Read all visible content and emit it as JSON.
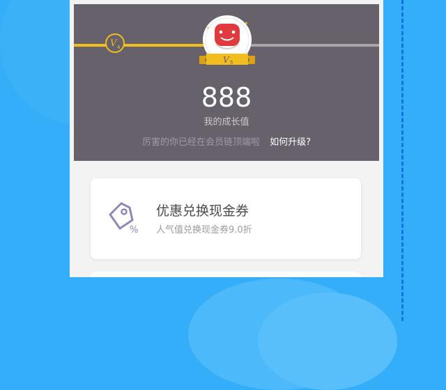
{
  "colors": {
    "background": "#34aef8",
    "banner": "#67616b",
    "progress_done": "#f2bd1f",
    "progress_todo": "#a7a5a6",
    "badge_red": "#e03a3e",
    "coupon_icon": "#8c88b8"
  },
  "growth": {
    "current_level_badge": "V4",
    "next_level_badge": "V5",
    "value": "888",
    "label": "我的成长值",
    "status_text": "厉害的你已经在会员链顶端啦",
    "upgrade_link": "如何升级?"
  },
  "benefits": [
    {
      "icon": "coupon-tag-icon",
      "title": "优惠兑换现金券",
      "description": "人气值兑换现金券9.0折"
    }
  ]
}
